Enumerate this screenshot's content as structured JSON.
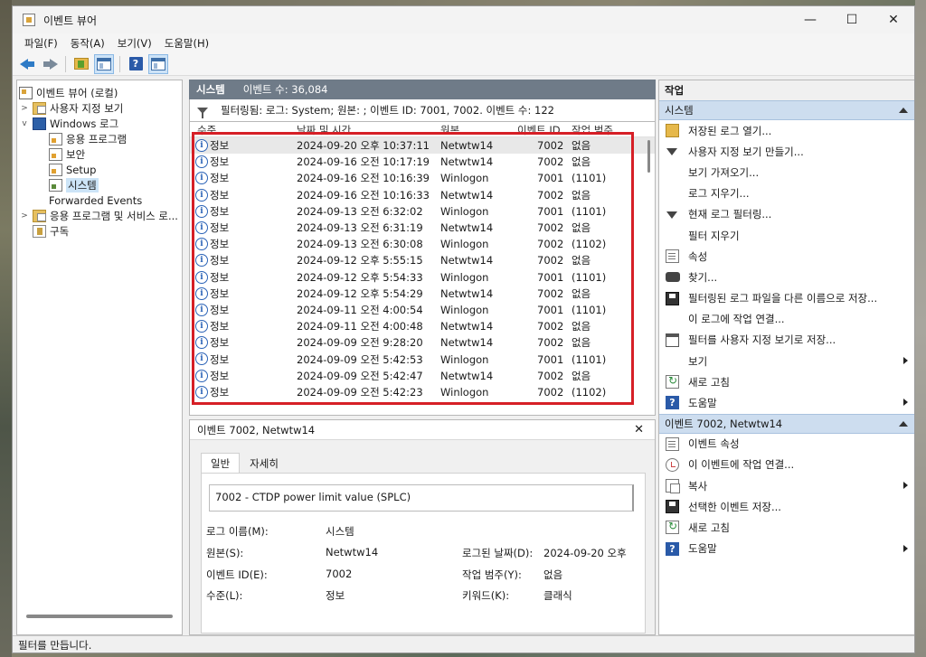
{
  "window": {
    "title": "이벤트 뷰어"
  },
  "menu": [
    "파일(F)",
    "동작(A)",
    "보기(V)",
    "도움말(H)"
  ],
  "tree": {
    "root": "이벤트 뷰어 (로컬)",
    "custom_views": "사용자 지정 보기",
    "windows_logs": "Windows 로그",
    "logs": [
      "응용 프로그램",
      "보안",
      "Setup",
      "시스템",
      "Forwarded Events"
    ],
    "app_services": "응용 프로그램 및 서비스 로...",
    "subscriptions": "구독"
  },
  "center": {
    "log_name": "시스템",
    "event_count": "이벤트 수: 36,084",
    "filter_text": "필터링됨: 로그: System; 원본: ; 이벤트 ID: 7001, 7002. 이벤트 수: 122",
    "columns": [
      "수준",
      "날짜 및 시간",
      "원본",
      "이벤트 ID",
      "작업 범주"
    ],
    "rows": [
      {
        "level": "정보",
        "datetime": "2024-09-20 오후 10:37:11",
        "source": "Netwtw14",
        "id": "7002",
        "category": "없음"
      },
      {
        "level": "정보",
        "datetime": "2024-09-16 오전 10:17:19",
        "source": "Netwtw14",
        "id": "7002",
        "category": "없음"
      },
      {
        "level": "정보",
        "datetime": "2024-09-16 오전 10:16:39",
        "source": "Winlogon",
        "id": "7001",
        "category": "(1101)"
      },
      {
        "level": "정보",
        "datetime": "2024-09-16 오전 10:16:33",
        "source": "Netwtw14",
        "id": "7002",
        "category": "없음"
      },
      {
        "level": "정보",
        "datetime": "2024-09-13 오전 6:32:02",
        "source": "Winlogon",
        "id": "7001",
        "category": "(1101)"
      },
      {
        "level": "정보",
        "datetime": "2024-09-13 오전 6:31:19",
        "source": "Netwtw14",
        "id": "7002",
        "category": "없음"
      },
      {
        "level": "정보",
        "datetime": "2024-09-13 오전 6:30:08",
        "source": "Winlogon",
        "id": "7002",
        "category": "(1102)"
      },
      {
        "level": "정보",
        "datetime": "2024-09-12 오후 5:55:15",
        "source": "Netwtw14",
        "id": "7002",
        "category": "없음"
      },
      {
        "level": "정보",
        "datetime": "2024-09-12 오후 5:54:33",
        "source": "Winlogon",
        "id": "7001",
        "category": "(1101)"
      },
      {
        "level": "정보",
        "datetime": "2024-09-12 오후 5:54:29",
        "source": "Netwtw14",
        "id": "7002",
        "category": "없음"
      },
      {
        "level": "정보",
        "datetime": "2024-09-11 오전 4:00:54",
        "source": "Winlogon",
        "id": "7001",
        "category": "(1101)"
      },
      {
        "level": "정보",
        "datetime": "2024-09-11 오전 4:00:48",
        "source": "Netwtw14",
        "id": "7002",
        "category": "없음"
      },
      {
        "level": "정보",
        "datetime": "2024-09-09 오전 9:28:20",
        "source": "Netwtw14",
        "id": "7002",
        "category": "없음"
      },
      {
        "level": "정보",
        "datetime": "2024-09-09 오전 5:42:53",
        "source": "Winlogon",
        "id": "7001",
        "category": "(1101)"
      },
      {
        "level": "정보",
        "datetime": "2024-09-09 오전 5:42:47",
        "source": "Netwtw14",
        "id": "7002",
        "category": "없음"
      },
      {
        "level": "정보",
        "datetime": "2024-09-09 오전 5:42:23",
        "source": "Winlogon",
        "id": "7002",
        "category": "(1102)"
      }
    ],
    "highlight_color": "#d61f26"
  },
  "detail": {
    "title": "이벤트 7002, Netwtw14",
    "tabs": [
      "일반",
      "자세히"
    ],
    "description": "7002 - CTDP power limit value (SPLC)",
    "log_name_label": "로그 이름(M):",
    "log_name_value": "시스템",
    "source_label": "원본(S):",
    "source_value": "Netwtw14",
    "logged_label": "로그된 날짜(D):",
    "logged_value": "2024-09-20 오후",
    "event_id_label": "이벤트 ID(E):",
    "event_id_value": "7002",
    "task_label": "작업 범주(Y):",
    "task_value": "없음",
    "level_label": "수준(L):",
    "level_value": "정보",
    "keywords_label": "키워드(K):",
    "keywords_value": "클래식"
  },
  "actions": {
    "title": "작업",
    "section1": "시스템",
    "items1": [
      {
        "label": "저장된 로그 열기...",
        "icon": "open-icon",
        "submenu": false
      },
      {
        "label": "사용자 지정 보기 만들기...",
        "icon": "filter-icon",
        "submenu": false
      },
      {
        "label": "보기 가져오기...",
        "icon": "",
        "submenu": false
      },
      {
        "label": "로그 지우기...",
        "icon": "",
        "submenu": false
      },
      {
        "label": "현재 로그 필터링...",
        "icon": "filter-icon",
        "submenu": false
      },
      {
        "label": "필터 지우기",
        "icon": "",
        "submenu": false
      },
      {
        "label": "속성",
        "icon": "properties-icon",
        "submenu": false
      },
      {
        "label": "찾기...",
        "icon": "binoculars-icon",
        "submenu": false
      },
      {
        "label": "필터링된 로그 파일을 다른 이름으로 저장...",
        "icon": "save-icon",
        "submenu": false
      },
      {
        "label": "이 로그에 작업 연결...",
        "icon": "",
        "submenu": false
      },
      {
        "label": "필터를 사용자 지정 보기로 저장...",
        "icon": "view-icon",
        "submenu": false
      },
      {
        "label": "보기",
        "icon": "",
        "submenu": true
      },
      {
        "label": "새로 고침",
        "icon": "refresh-icon",
        "submenu": false
      },
      {
        "label": "도움말",
        "icon": "help-icon",
        "submenu": true
      }
    ],
    "section2": "이벤트 7002, Netwtw14",
    "items2": [
      {
        "label": "이벤트 속성",
        "icon": "properties-icon",
        "submenu": false
      },
      {
        "label": "이 이벤트에 작업 연결...",
        "icon": "task-icon",
        "submenu": false
      },
      {
        "label": "복사",
        "icon": "copy-icon",
        "submenu": true
      },
      {
        "label": "선택한 이벤트 저장...",
        "icon": "save-icon",
        "submenu": false
      },
      {
        "label": "새로 고침",
        "icon": "refresh-icon",
        "submenu": false
      },
      {
        "label": "도움말",
        "icon": "help-icon",
        "submenu": true
      }
    ]
  },
  "status": "필터를 만듭니다."
}
